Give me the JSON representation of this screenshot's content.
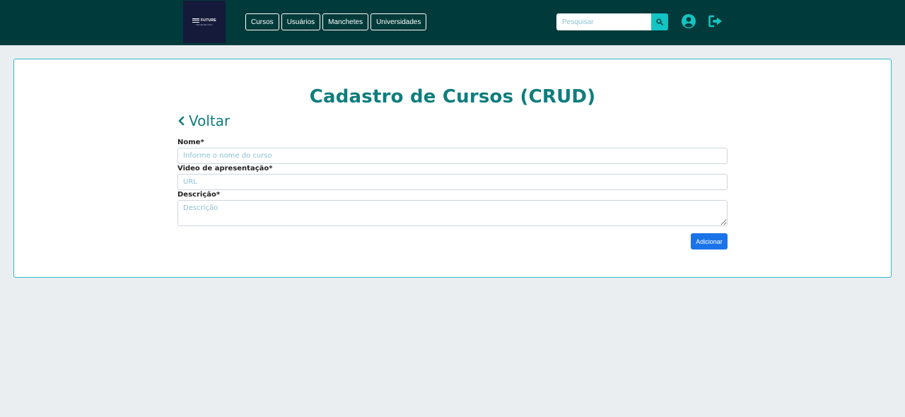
{
  "header": {
    "logo": {
      "main": "FUTURE",
      "sub": "TECHNOLOGY"
    },
    "nav": [
      {
        "label": "Cursos"
      },
      {
        "label": "Usuários"
      },
      {
        "label": "Manchetes"
      },
      {
        "label": "Universidades"
      }
    ],
    "search": {
      "placeholder": "Pesquisar",
      "icon": "search-icon"
    },
    "user_icon": "user-circle-icon",
    "logout_icon": "logout-icon"
  },
  "form": {
    "title": "Cadastro de Cursos (CRUD)",
    "back_label": "Voltar",
    "fields": {
      "name": {
        "label": "Nome*",
        "placeholder": "Informe o nome do curso"
      },
      "video": {
        "label": "Video de apresentação*",
        "placeholder": "URL"
      },
      "description": {
        "label": "Descrição*",
        "placeholder": "Descrição"
      }
    },
    "submit_label": "Adicionar"
  },
  "colors": {
    "header_bg": "#013a3a",
    "accent": "#14c4c4",
    "title": "#0f7d7d",
    "primary_button": "#1a73e8",
    "page_bg": "#ebeef1"
  }
}
